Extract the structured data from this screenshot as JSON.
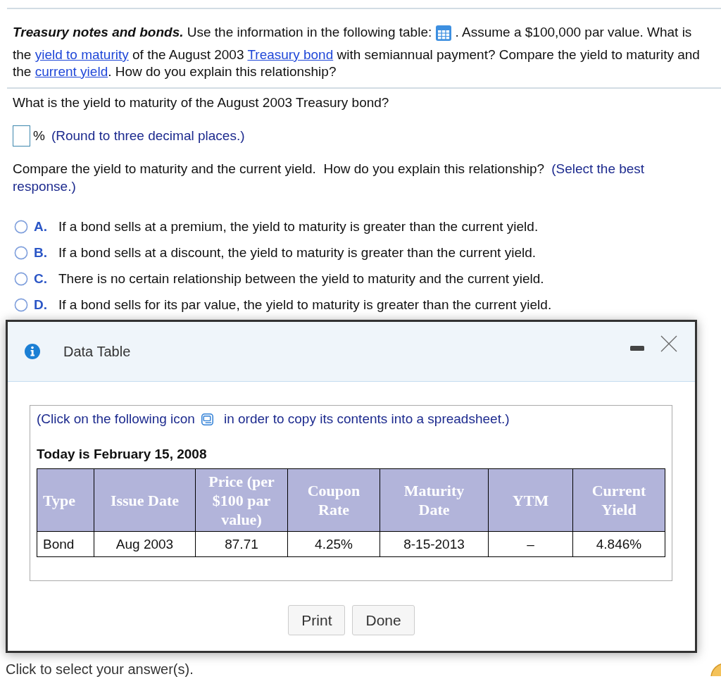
{
  "question": {
    "segments": [
      {
        "kind": "lead",
        "text": "Treasury notes and bonds."
      },
      {
        "kind": "text",
        "text": " Use the information in the following table: "
      },
      {
        "kind": "icon"
      },
      {
        "kind": "text",
        "text": ". Assume a $100,000 par value. What is the "
      },
      {
        "kind": "link",
        "text": "yield to maturity"
      },
      {
        "kind": "text",
        "text": " of the August 2003 "
      },
      {
        "kind": "link",
        "text": "Treasury bond"
      },
      {
        "kind": "text",
        "text": " with semiannual payment? Compare the yield to maturity and the "
      },
      {
        "kind": "link",
        "text": "current yield"
      },
      {
        "kind": "text",
        "text": ". How do you explain this relationship?"
      }
    ]
  },
  "part1": {
    "prompt": "What is the yield to maturity of the August 2003 Treasury bond?",
    "unit": "%",
    "hint": "(Round to three decimal places.)"
  },
  "part2": {
    "prompt": "Compare the yield to maturity and the current yield.  How do you explain this relationship?",
    "instruction": "(Select the best response.)",
    "options": [
      {
        "letter": "A.",
        "text": "If a bond sells at a premium, the yield to maturity is greater than the current yield.",
        "selected": false
      },
      {
        "letter": "B.",
        "text": "If a bond sells at a discount, the yield to maturity is greater than the current yield.",
        "selected": false
      },
      {
        "letter": "C.",
        "text": "There is no certain relationship between the yield to maturity and the current yield.",
        "selected": false
      },
      {
        "letter": "D.",
        "text": "If a bond sells for its par value, the yield to maturity is greater than the current yield.",
        "selected": false
      }
    ]
  },
  "dialog": {
    "title": "Data Table",
    "note_before": "(Click on the following icon",
    "note_after": "in order to copy its contents into a spreadsheet.)",
    "date_line": "Today is February 15, 2008",
    "table": {
      "columns": [
        "Type",
        "Issue Date",
        "Price (per $100 par value)",
        "Coupon Rate",
        "Maturity Date",
        "YTM",
        "Current Yield"
      ],
      "rows": [
        [
          "Bond",
          "Aug 2003",
          "87.71",
          "4.25%",
          "8-15-2013",
          "–",
          "4.846%"
        ]
      ]
    },
    "buttons": [
      "Print",
      "Done"
    ]
  },
  "footer": {
    "text": "Click to select your answer(s)."
  }
}
